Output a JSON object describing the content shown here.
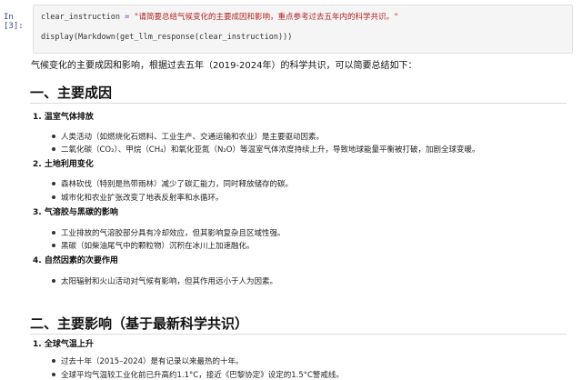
{
  "cell": {
    "prompt": "In [3]:",
    "line1": {
      "var": "clear_instruction",
      "op": " = ",
      "str": "\"请简要总结气候变化的主要成因和影响，重点参考过去五年内的科学共识。\""
    },
    "line2": "display(Markdown(get_llm_response(clear_instruction)))"
  },
  "output": {
    "intro": "气候变化的主要成因和影响，根据过去五年（2019-2024年）的科学共识，可以简要总结如下：",
    "section1": {
      "title": "一、主要成因",
      "items": [
        {
          "title": "1. 温室气体排放",
          "bullets": [
            "人类活动（如燃烧化石燃料、工业生产、交通运输和农业）是主要驱动因素。",
            "二氧化碳（CO₂）、甲烷（CH₄）和氧化亚氮（N₂O）等温室气体浓度持续上升，导致地球能量平衡被打破，加剧全球变暖。"
          ]
        },
        {
          "title": "2. 土地利用变化",
          "bullets": [
            "森林砍伐（特别是热带雨林）减少了碳汇能力，同时释放储存的碳。",
            "城市化和农业扩张改变了地表反射率和水循环。"
          ]
        },
        {
          "title": "3. 气溶胶与黑碳的影响",
          "bullets": [
            "工业排放的气溶胶部分具有冷却效应，但其影响复杂且区域性强。",
            "黑碳（如柴油尾气中的颗粒物）沉积在冰川上加速融化。"
          ]
        },
        {
          "title": "4. 自然因素的次要作用",
          "bullets": [
            "太阳辐射和火山活动对气候有影响，但其作用远小于人为因素。"
          ]
        }
      ]
    },
    "section2": {
      "title": "二、主要影响（基于最新科学共识）",
      "items": [
        {
          "title": "1. 全球气温上升",
          "bullets": [
            "过去十年（2015–2024）是有记录以来最热的十年。",
            "全球平均气温较工业化前已升高约1.1°C，接近《巴黎协定》设定的1.5°C警戒线。"
          ]
        }
      ]
    }
  }
}
